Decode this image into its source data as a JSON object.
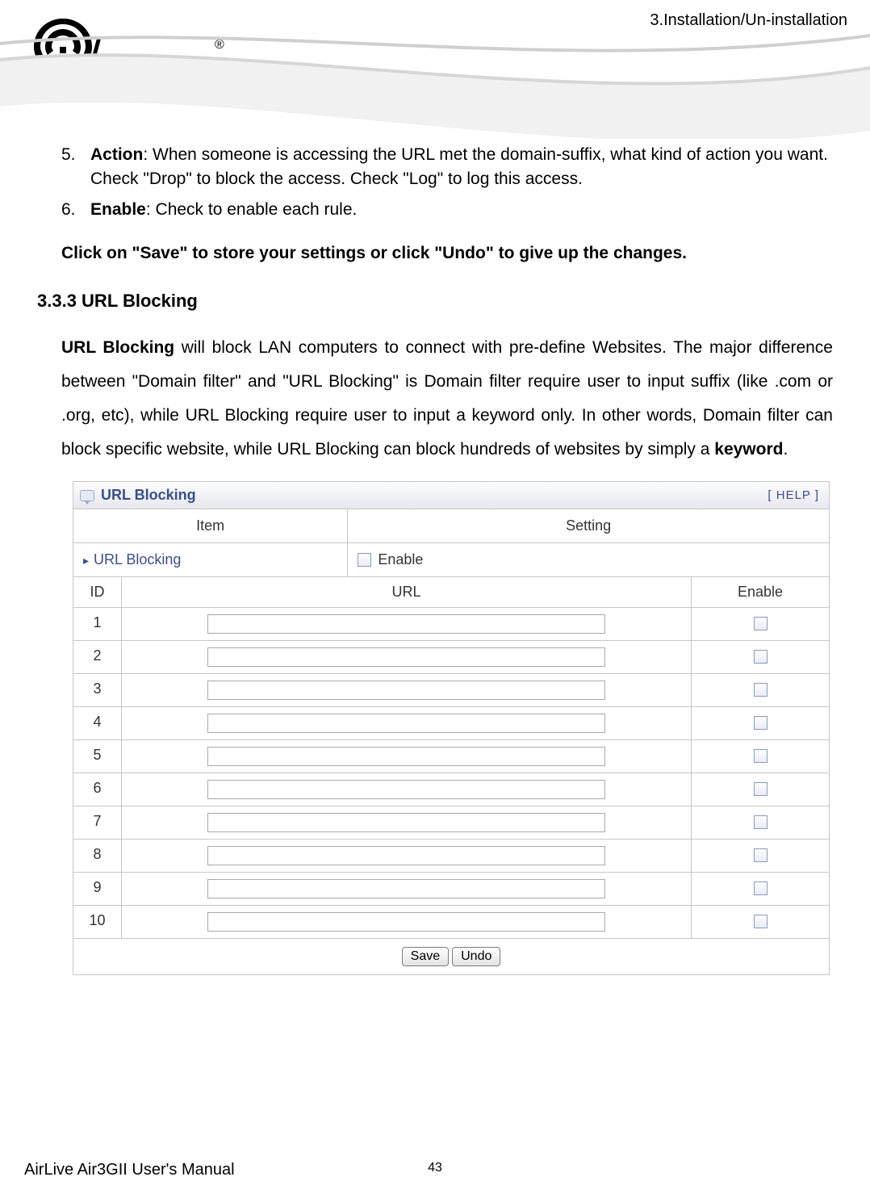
{
  "header": {
    "chapter_label": "3.Installation/Un-installation",
    "logo_text": "Air Live",
    "logo_reg": "®"
  },
  "list": {
    "item5_num": "5.",
    "item5_bold": "Action",
    "item5_text_line1": ":  When  someone  is  accessing  the  URL  met  the  domain-suffix,  what  kind  of action you want.",
    "item5_text_line2": "Check \"Drop\" to block the access. Check \"Log\" to log this access.",
    "item6_num": "6.",
    "item6_bold": "Enable",
    "item6_text": ": Check to enable each rule."
  },
  "save_undo_note": "Click on \"Save\" to store your settings or click \"Undo\" to give up the changes.",
  "section_heading": "3.3.3 URL Blocking",
  "paragraph": {
    "bold_lead": "URL Blocking",
    "body": " will block LAN computers to connect with pre-define Websites. The major difference between \"Domain filter\" and \"URL Blocking\" is Domain filter require user to input suffix (like .com or .org, etc), while URL Blocking require user to input a keyword only. In other words, Domain filter can block specific website, while URL Blocking can block hundreds of websites by simply a ",
    "bold_tail": "keyword",
    "tail_dot": "."
  },
  "panel": {
    "title": "URL Blocking",
    "help_label": "[ HELP ]",
    "item_header": "Item",
    "setting_header": "Setting",
    "item_label": "URL Blocking",
    "enable_label": "Enable",
    "columns": {
      "id": "ID",
      "url": "URL",
      "enable": "Enable"
    },
    "rows": [
      {
        "id": "1",
        "url": "",
        "enable": false
      },
      {
        "id": "2",
        "url": "",
        "enable": false
      },
      {
        "id": "3",
        "url": "",
        "enable": false
      },
      {
        "id": "4",
        "url": "",
        "enable": false
      },
      {
        "id": "5",
        "url": "",
        "enable": false
      },
      {
        "id": "6",
        "url": "",
        "enable": false
      },
      {
        "id": "7",
        "url": "",
        "enable": false
      },
      {
        "id": "8",
        "url": "",
        "enable": false
      },
      {
        "id": "9",
        "url": "",
        "enable": false
      },
      {
        "id": "10",
        "url": "",
        "enable": false
      }
    ],
    "save_btn": "Save",
    "undo_btn": "Undo"
  },
  "footer": {
    "manual_title": "AirLive Air3GII User's Manual",
    "page_number": "43"
  }
}
